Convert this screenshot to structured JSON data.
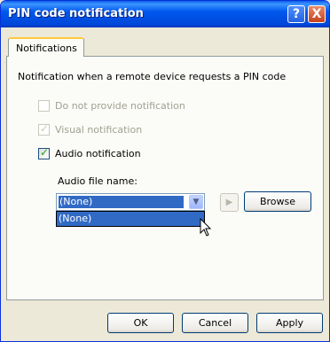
{
  "window": {
    "title": "PIN code notification",
    "help_icon": "?",
    "close_icon": "X"
  },
  "tab": {
    "label": "Notifications"
  },
  "description": "Notification when a remote device requests a PIN code",
  "options": [
    {
      "label": "Do not provide notification",
      "checked": false,
      "enabled": false
    },
    {
      "label": "Visual notification",
      "checked": true,
      "enabled": false
    },
    {
      "label": "Audio notification",
      "checked": true,
      "enabled": true
    }
  ],
  "audio": {
    "label": "Audio file name:",
    "selected": "(None)",
    "dropdown_options": [
      "(None)"
    ],
    "play_icon": "play-icon",
    "browse_label": "Browse"
  },
  "buttons": {
    "ok": "OK",
    "cancel": "Cancel",
    "apply": "Apply"
  }
}
